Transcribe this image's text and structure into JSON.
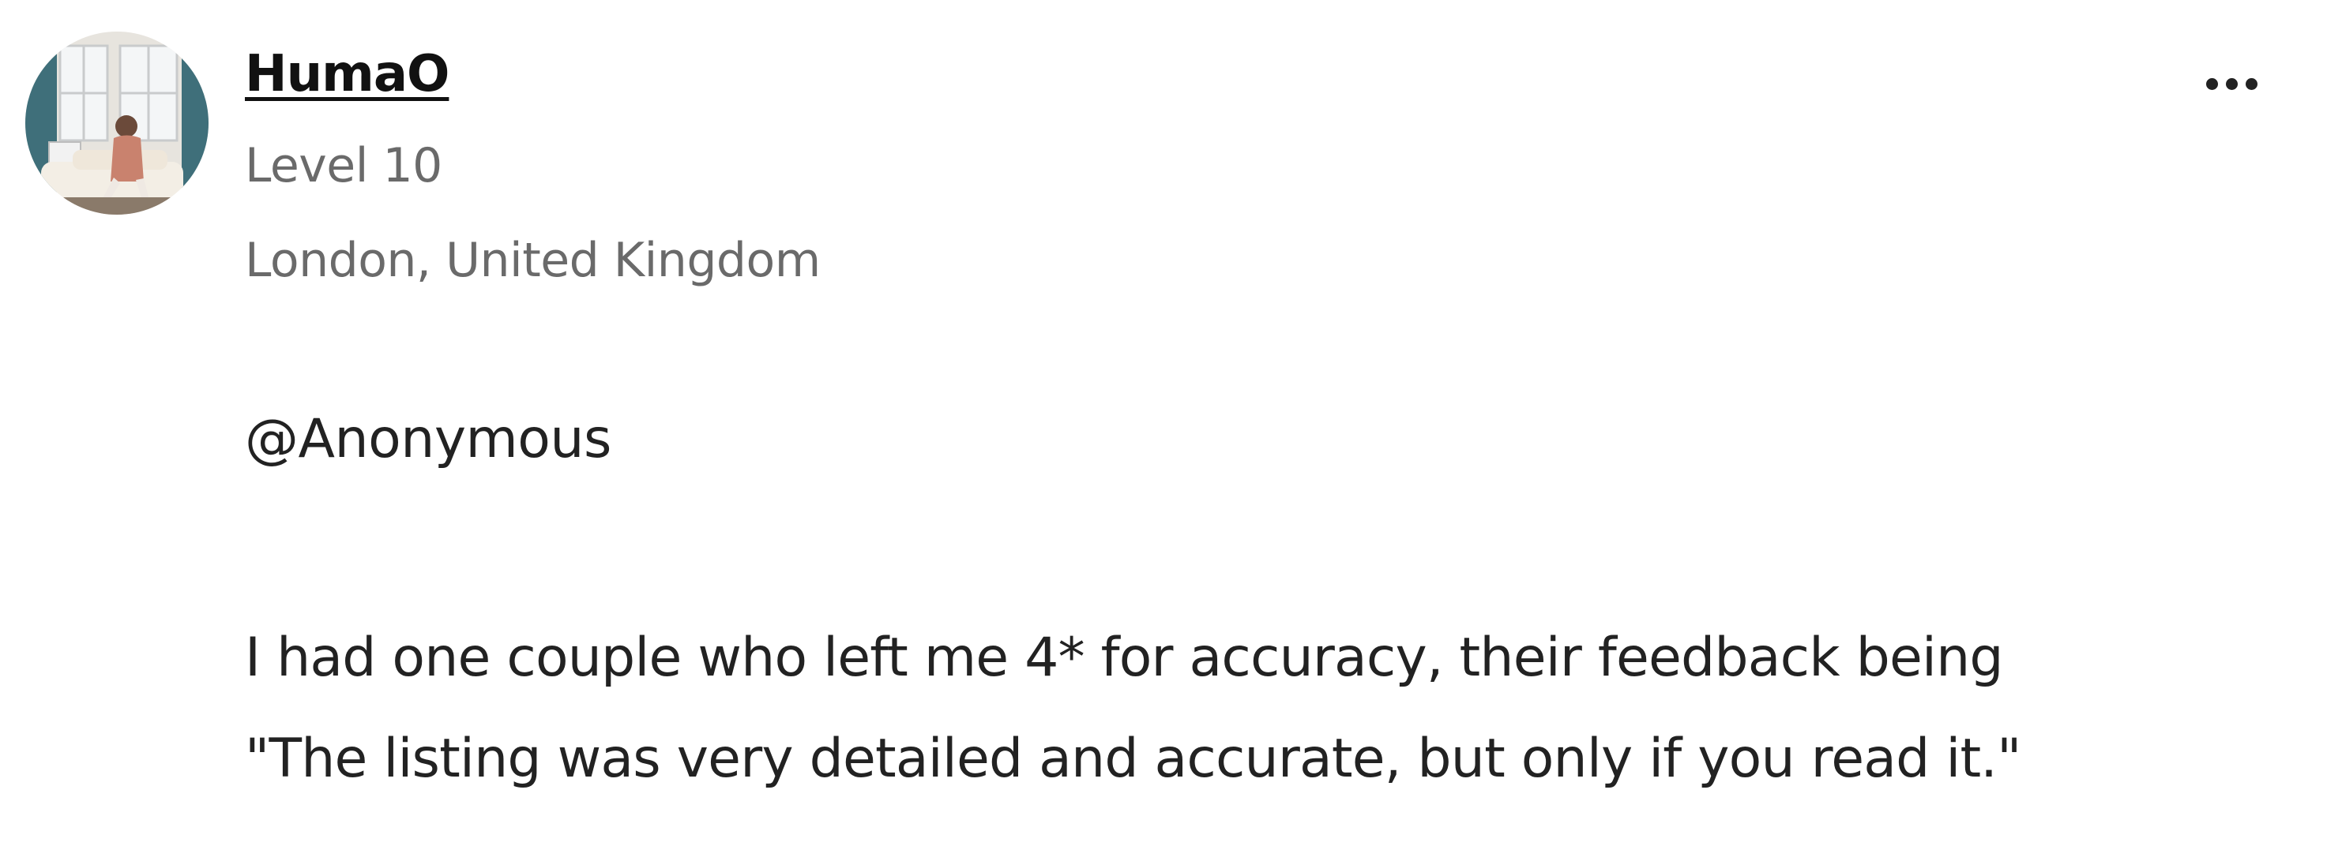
{
  "post": {
    "author": {
      "username": "HumaO",
      "level": "Level 10",
      "location": "London, United Kingdom"
    },
    "mention": "@Anonymous",
    "body_lines": [
      "I had one couple who left me 4* for accuracy, their feedback being",
      "\"The listing was very detailed and accurate, but only if you read it.\""
    ],
    "more_icon": "more-horizontal-icon"
  }
}
